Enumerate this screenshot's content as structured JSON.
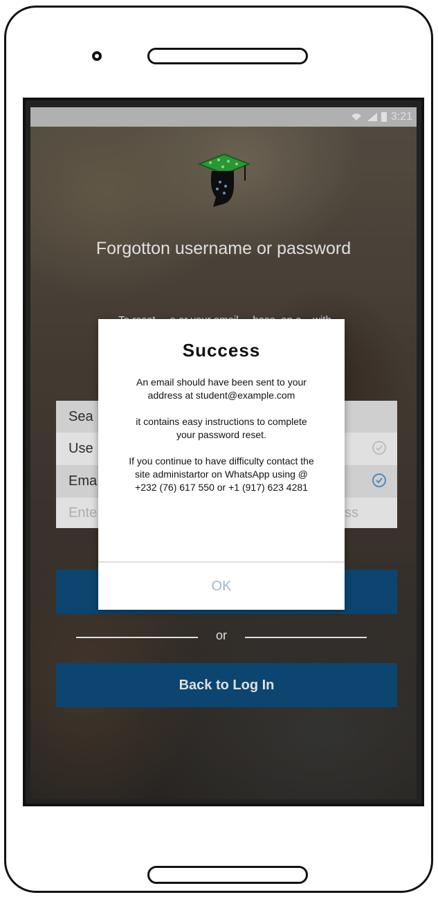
{
  "status_bar": {
    "time": "3:21",
    "icons": [
      "wifi-icon",
      "signal-icon",
      "battery-icon"
    ]
  },
  "logo": {
    "icon": "graduation-cap-logo"
  },
  "page": {
    "title": "Forgotton username or password",
    "intro_visible": "To reset ... e or your email ... base, an e... with"
  },
  "form": {
    "search_label": "Sea",
    "username_label": "Use",
    "email_label": "Ema",
    "input_placeholder": "Ente",
    "input_placeholder_tail": "ss"
  },
  "buttons": {
    "submit_label": "",
    "divider_label": "or",
    "back_label": "Back to Log In"
  },
  "dialog": {
    "title": "Success",
    "message_1": "An email should have been sent to your address at student@example.com",
    "message_2": "it contains easy instructions to complete your password reset.",
    "message_3": "If you continue to have difficulty contact the site administartor on WhatsApp using @ +232 (76) 617 550 or +1 (917) 623 4281",
    "ok_label": "OK"
  },
  "colors": {
    "primary": "#0d4f80",
    "ok_text": "#9cb8d0",
    "check_active": "#5a9fd4"
  }
}
